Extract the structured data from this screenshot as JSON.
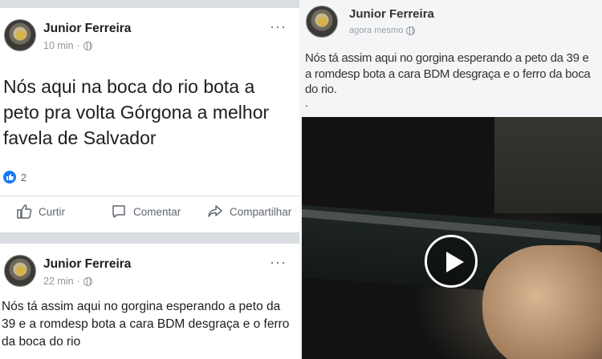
{
  "post1": {
    "author": "Junior Ferreira",
    "time": "10 min",
    "text": "Nós aqui na boca do rio bota a peto pra volta Górgona a melhor favela de Salvador",
    "reaction_count": "2",
    "more": "···",
    "actions": {
      "like": "Curtir",
      "comment": "Comentar",
      "share": "Compartilhar"
    }
  },
  "post2": {
    "author": "Junior Ferreira",
    "time": "22 min",
    "text": "Nós tá assim aqui no gorgina esperando a peto da 39 e a romdesp bota a cara BDM desgraça e o ferro da boca do rio",
    "more": "···"
  },
  "screenshot_post": {
    "author": "Junior Ferreira",
    "time": "agora mesmo",
    "text": "Nós tá assim aqui no gorgina esperando a peto da 39 e a romdesp bota a cara BDM desgraça e o ferro da boca do rio.",
    "trailing": "."
  },
  "colors": {
    "accent": "#1877f2",
    "meta": "#90949c",
    "action": "#606770"
  },
  "icons": [
    "globe-icon",
    "like-icon",
    "comment-icon",
    "share-icon",
    "more-icon",
    "play-icon"
  ]
}
